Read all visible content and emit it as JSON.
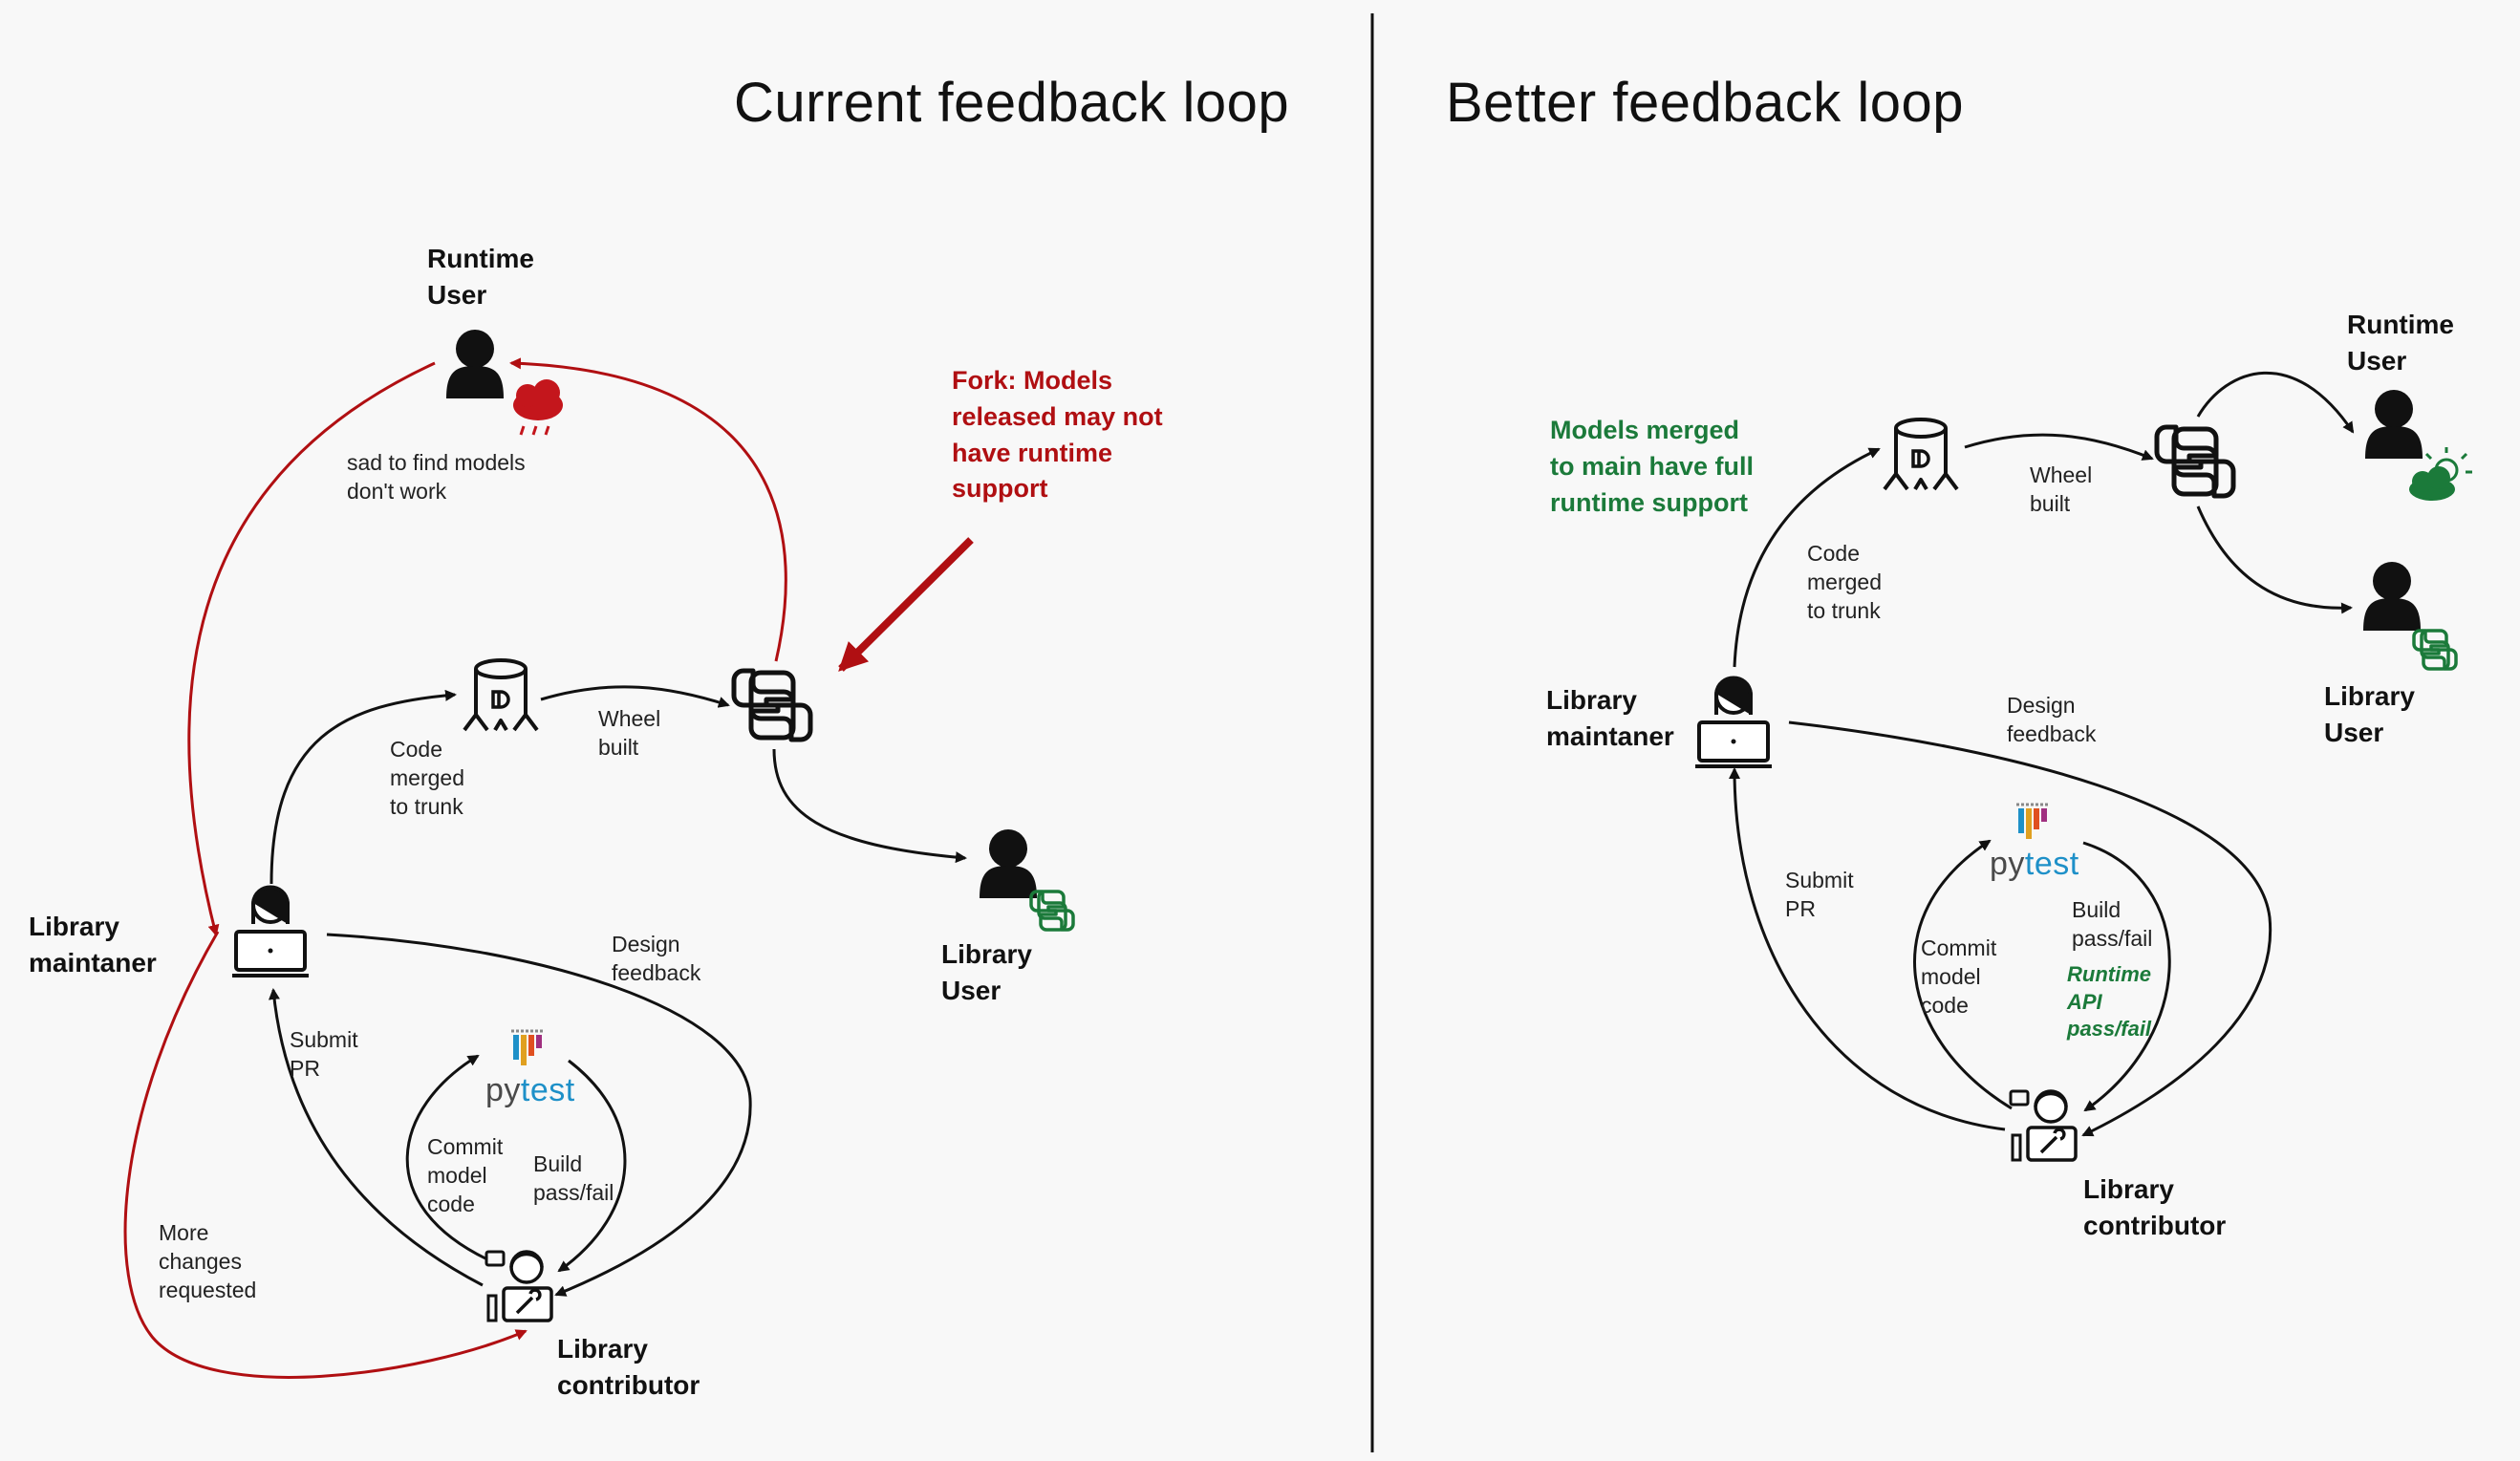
{
  "titles": {
    "current": "Current feedback loop",
    "better": "Better feedback loop"
  },
  "left": {
    "runtime_user": "Runtime\nUser",
    "sad_note": "sad to find models\ndon't work",
    "fork_note": "Fork: Models\nreleased may not\nhave runtime\nsupport",
    "code_merged": "Code\nmerged\nto trunk",
    "wheel_built": "Wheel\nbuilt",
    "library_maintainer": "Library\nmaintaner",
    "design_feedback": "Design\nfeedback",
    "library_user": "Library\nUser",
    "submit_pr": "Submit\nPR",
    "pytest_a": "py",
    "pytest_b": "test",
    "commit_model_code": "Commit\nmodel\ncode",
    "build_pass_fail": "Build\npass/fail",
    "more_changes": "More\nchanges\nrequested",
    "library_contributor": "Library\ncontributor"
  },
  "right": {
    "models_merged_note": "Models merged\nto main have full\nruntime support",
    "runtime_user": "Runtime\nUser",
    "wheel_built": "Wheel\nbuilt",
    "code_merged": "Code\nmerged\nto trunk",
    "library_maintainer": "Library\nmaintaner",
    "design_feedback": "Design\nfeedback",
    "library_user": "Library\nUser",
    "submit_pr": "Submit\nPR",
    "pytest_a": "py",
    "pytest_b": "test",
    "commit_model_code": "Commit\nmodel\ncode",
    "build_pass_fail": "Build\npass/fail",
    "runtime_api": "Runtime\nAPI\npass/fail",
    "library_contributor": "Library\ncontributor"
  },
  "icons": {
    "user": "user-icon",
    "rain_cloud": "rain-cloud-icon",
    "sun_cloud": "sun-cloud-icon",
    "python": "python-logo-icon",
    "trunk": "tree-trunk-icon",
    "maintainer": "maintainer-laptop-icon",
    "contributor": "contributor-laptop-icon",
    "pytest": "pytest-logo-icon"
  },
  "colors": {
    "red": "#b00f12",
    "green": "#1b7a3a",
    "line": "#111111"
  }
}
